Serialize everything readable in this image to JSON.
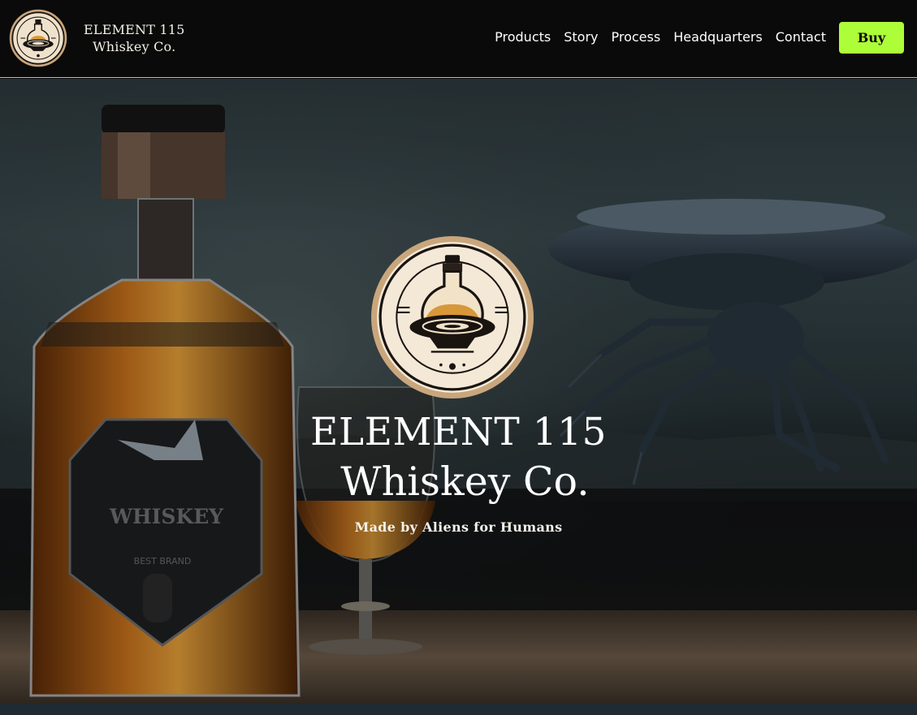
{
  "brand": {
    "line1": "ELEMENT 115",
    "line2": "Whiskey Co."
  },
  "nav": {
    "items": [
      {
        "label": "Products"
      },
      {
        "label": "Story"
      },
      {
        "label": "Process"
      },
      {
        "label": "Headquarters"
      },
      {
        "label": "Contact"
      }
    ],
    "buy_label": "Buy"
  },
  "hero": {
    "title_line1": "ELEMENT 115",
    "title_line2": "Whiskey Co.",
    "tagline": "Made by Aliens for Humans",
    "bottle_label_text": "WHISKEY",
    "bottle_sub_text": "BEST BRAND"
  },
  "colors": {
    "accent": "#adfe39",
    "header_bg": "#0a0a0a",
    "header_border": "#9cd96a"
  },
  "icons": {
    "logo": "ufo-decanter-emblem"
  }
}
